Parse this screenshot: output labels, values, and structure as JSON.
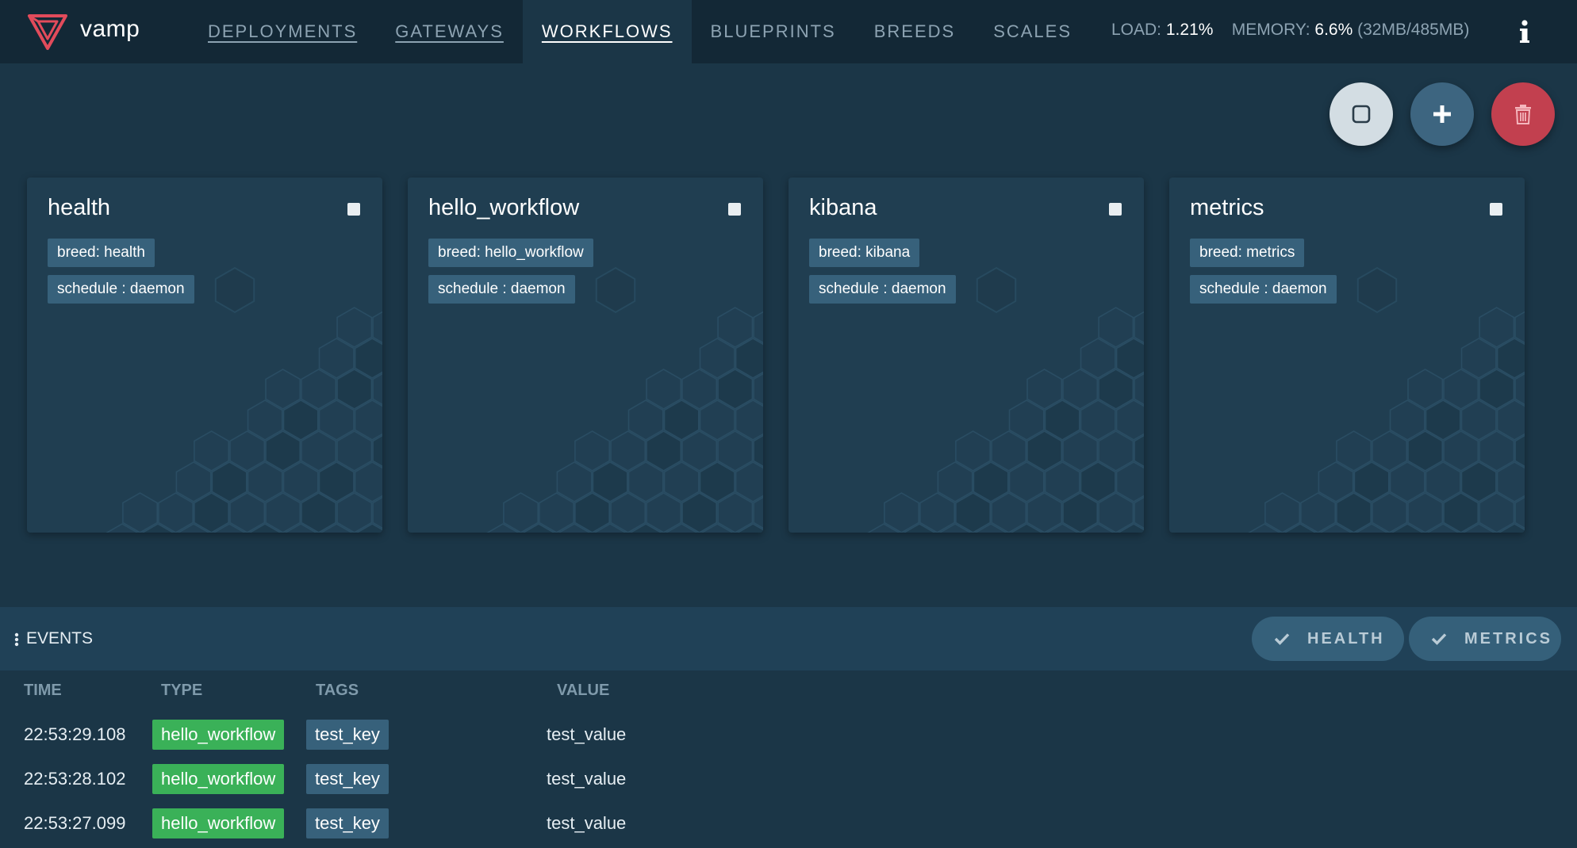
{
  "app": {
    "name": "vamp"
  },
  "nav": [
    {
      "label": "DEPLOYMENTS"
    },
    {
      "label": "GATEWAYS"
    },
    {
      "label": "WORKFLOWS"
    },
    {
      "label": "BLUEPRINTS"
    },
    {
      "label": "BREEDS"
    },
    {
      "label": "SCALES"
    }
  ],
  "nav_active": "WORKFLOWS",
  "stats": {
    "load_label": "LOAD:",
    "load_value": "1.21%",
    "memory_label": "MEMORY:",
    "memory_value": "6.6%",
    "memory_detail": "(32MB/485MB)"
  },
  "icons": {
    "info": "info-icon",
    "select_all": "square-icon",
    "add": "plus-icon",
    "delete": "trash-icon",
    "check": "check-icon"
  },
  "colors": {
    "background": "#1b3647",
    "topbar": "#132836",
    "card": "#203e51",
    "tag": "#37617b",
    "type_badge": "#3ab158",
    "delete": "#c2404f",
    "accent_logo": "#e24b5b"
  },
  "workflows": [
    {
      "name": "health",
      "breed": "breed: health",
      "schedule": "schedule : daemon"
    },
    {
      "name": "hello_workflow",
      "breed": "breed: hello_workflow",
      "schedule": "schedule : daemon"
    },
    {
      "name": "kibana",
      "breed": "breed: kibana",
      "schedule": "schedule : daemon"
    },
    {
      "name": "metrics",
      "breed": "breed: metrics",
      "schedule": "schedule : daemon"
    }
  ],
  "events": {
    "title": "EVENTS",
    "filters": [
      {
        "label": "HEALTH",
        "checked": true
      },
      {
        "label": "METRICS",
        "checked": true
      }
    ],
    "columns": [
      "TIME",
      "TYPE",
      "TAGS",
      "VALUE"
    ],
    "rows": [
      {
        "time": "22:53:29.108",
        "type": "hello_workflow",
        "tag": "test_key",
        "value": "test_value"
      },
      {
        "time": "22:53:28.102",
        "type": "hello_workflow",
        "tag": "test_key",
        "value": "test_value"
      },
      {
        "time": "22:53:27.099",
        "type": "hello_workflow",
        "tag": "test_key",
        "value": "test_value"
      }
    ]
  }
}
